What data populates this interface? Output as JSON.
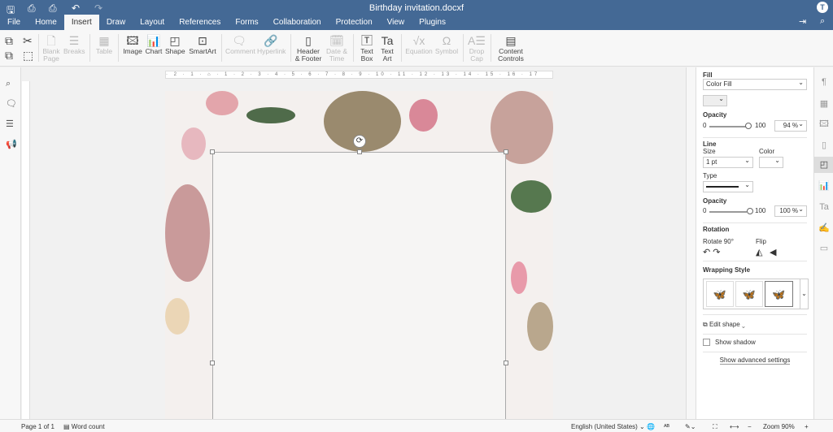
{
  "title": "Birthday invitation.docxf",
  "avatar": "T",
  "tabs": [
    "File",
    "Home",
    "Insert",
    "Draw",
    "Layout",
    "References",
    "Forms",
    "Collaboration",
    "Protection",
    "View",
    "Plugins"
  ],
  "toolbar": {
    "blank_page": "Blank Page",
    "breaks": "Breaks",
    "table": "Table",
    "image": "Image",
    "chart": "Chart",
    "shape": "Shape",
    "smartart": "SmartArt",
    "comment": "Comment",
    "hyperlink": "Hyperlink",
    "header_footer": "Header & Footer",
    "date_time": "Date & Time",
    "text_box": "Text Box",
    "text_art": "Text Art",
    "equation": "Equation",
    "symbol": "Symbol",
    "drop_cap": "Drop Cap",
    "content_controls": "Content Controls"
  },
  "panel": {
    "fill_label": "Fill",
    "fill_type": "Color Fill",
    "opacity_label": "Opacity",
    "min": "0",
    "max": "100",
    "fill_opacity": "94 %",
    "fill_opacity_value": 94,
    "line_label": "Line",
    "size_label": "Size",
    "size_value": "1 pt",
    "color_label": "Color",
    "type_label": "Type",
    "line_opacity": "100 %",
    "line_opacity_value": 100,
    "rotation_label": "Rotation",
    "rotate90": "Rotate 90°",
    "flip": "Flip",
    "wrapping_label": "Wrapping Style",
    "edit_shape": "Edit shape",
    "show_shadow": "Show shadow",
    "advanced": "Show advanced settings"
  },
  "status": {
    "page": "Page 1 of 1",
    "word_count": "Word count",
    "language": "English (United States)",
    "zoom": "Zoom 90%"
  },
  "ruler": "· 2 · 1 · ⌂ · 1 · 2 · 3 · 4 · 5 · 6 · 7 · 8 · 9 · 10 · 11 · 12 · 13 · 14 · 15 · 16 · 17"
}
